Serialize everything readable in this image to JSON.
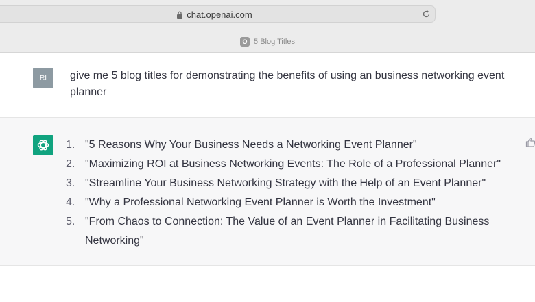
{
  "browser": {
    "url": "chat.openai.com",
    "tab_title": "5 Blog Titles",
    "favicon_letter": "O"
  },
  "user_message": {
    "avatar_initials": "RI",
    "text": "give me 5 blog titles for demonstrating the benefits of using an business networking event planner"
  },
  "assistant_message": {
    "items": [
      {
        "num": "1.",
        "text": "\"5 Reasons Why Your Business Needs a Networking Event Planner\""
      },
      {
        "num": "2.",
        "text": "\"Maximizing ROI at Business Networking Events: The Role of a Professional Planner\""
      },
      {
        "num": "3.",
        "text": "\"Streamline Your Business Networking Strategy with the Help of an Event Planner\""
      },
      {
        "num": "4.",
        "text": "\"Why a Professional Networking Event Planner is Worth the Investment\""
      },
      {
        "num": "5.",
        "text": "\"From Chaos to Connection: The Value of an Event Planner in Facilitating Business Networking\""
      }
    ]
  },
  "colors": {
    "assistant_accent": "#10a37f",
    "user_avatar": "#8d9aa2"
  }
}
